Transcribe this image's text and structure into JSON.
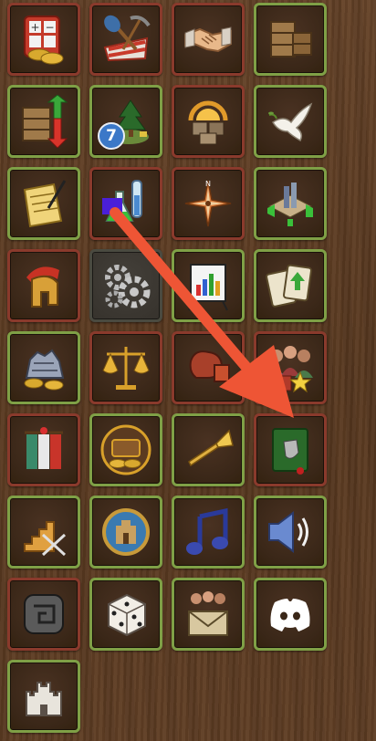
{
  "tiles": [
    {
      "name": "calculator-coins-icon",
      "border": "red",
      "badge": ""
    },
    {
      "name": "shovel-pickaxe-icon",
      "border": "red",
      "badge": ""
    },
    {
      "name": "handshake-icon",
      "border": "red",
      "badge": ""
    },
    {
      "name": "crates-icon",
      "border": "green",
      "badge": ""
    },
    {
      "name": "crate-exchange-icon",
      "border": "green",
      "badge": ""
    },
    {
      "name": "event-tree-icon",
      "border": "green",
      "badge": "7"
    },
    {
      "name": "sunrise-blocks-icon",
      "border": "red",
      "badge": ""
    },
    {
      "name": "peace-dove-icon",
      "border": "green",
      "badge": ""
    },
    {
      "name": "scroll-quill-icon",
      "border": "green",
      "badge": ""
    },
    {
      "name": "research-flask-icon",
      "border": "red",
      "badge": ""
    },
    {
      "name": "compass-icon",
      "border": "red",
      "badge": ""
    },
    {
      "name": "city-overview-icon",
      "border": "green",
      "badge": ""
    },
    {
      "name": "spartan-helmet-icon",
      "border": "red",
      "badge": ""
    },
    {
      "name": "settings-gears-icon",
      "border": "grey",
      "badge": ""
    },
    {
      "name": "statistics-easel-icon",
      "border": "green",
      "badge": ""
    },
    {
      "name": "cards-icon",
      "border": "green",
      "badge": ""
    },
    {
      "name": "guild-treasury-icon",
      "border": "green",
      "badge": ""
    },
    {
      "name": "balance-scales-icon",
      "border": "red",
      "badge": ""
    },
    {
      "name": "boxing-glove-icon",
      "border": "red",
      "badge": ""
    },
    {
      "name": "heroes-group-icon",
      "border": "red",
      "badge": ""
    },
    {
      "name": "banners-icon",
      "border": "red",
      "badge": ""
    },
    {
      "name": "treasure-chest-icon",
      "border": "green",
      "badge": ""
    },
    {
      "name": "trumpet-icon",
      "border": "green",
      "badge": ""
    },
    {
      "name": "shield-book-icon",
      "border": "red",
      "badge": ""
    },
    {
      "name": "pyramid-swords-icon",
      "border": "green",
      "badge": ""
    },
    {
      "name": "castle-medallion-icon",
      "border": "green",
      "badge": ""
    },
    {
      "name": "music-note-icon",
      "border": "green",
      "badge": ""
    },
    {
      "name": "speaker-icon",
      "border": "green",
      "badge": ""
    },
    {
      "name": "stone-rune-icon",
      "border": "red",
      "badge": ""
    },
    {
      "name": "dice-icon",
      "border": "green",
      "badge": ""
    },
    {
      "name": "mail-people-icon",
      "border": "green",
      "badge": ""
    },
    {
      "name": "discord-icon",
      "border": "green",
      "badge": ""
    },
    {
      "name": "castle-icon",
      "border": "green",
      "badge": ""
    }
  ],
  "colors": {
    "border_red": "#8a3a2c",
    "border_green": "#7fa046",
    "badge_blue": "#3b78c8",
    "arrow": "#ee5535",
    "marker": "#4a1fd8"
  }
}
